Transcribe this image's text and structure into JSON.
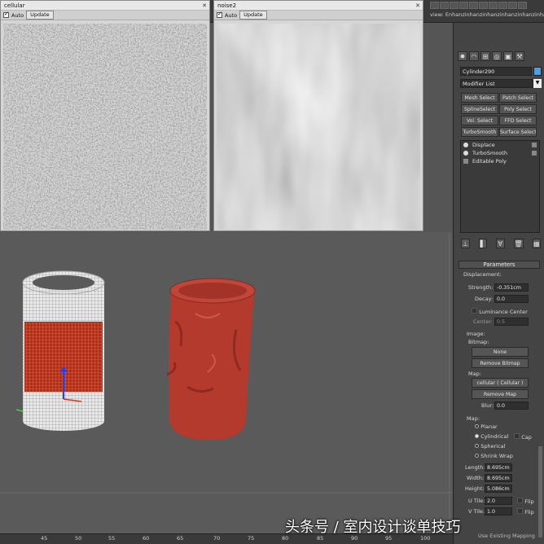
{
  "topbar": {
    "view_title": "view: Enhanzinhanzinhanzinhanzinhanzinhanzinhanz..."
  },
  "windows": [
    {
      "title": "cellular",
      "auto_label": "Auto",
      "update_label": "Update"
    },
    {
      "title": "noise2",
      "auto_label": "Auto",
      "update_label": "Update"
    }
  ],
  "command_panel": {
    "object_name": "Cylinder290",
    "modifier_list_label": "Modifier List",
    "modifier_buttons": [
      "Mesh Select",
      "Patch Select",
      "SplineSelect",
      "Poly Select",
      "Vol. Select",
      "FFD Select",
      "TurboSmooth",
      "Surface Select"
    ],
    "stack": [
      "Displace",
      "TurboSmooth",
      "Editable Poly"
    ],
    "parameters": {
      "rollout_title": "Parameters",
      "displacement_label": "Displacement:",
      "strength_label": "Strength:",
      "strength_value": "-0.351cm",
      "decay_label": "Decay:",
      "decay_value": "0.0",
      "luminance_center_label": "Luminance Center",
      "center_label": "Center:",
      "center_value": "0.5",
      "image_label": "Image:",
      "bitmap_label": "Bitmap:",
      "bitmap_button": "None",
      "remove_bitmap_button": "Remove Bitmap",
      "map_label": "Map:",
      "map_button": "cellular ( Cellular )",
      "remove_map_button": "Remove Map",
      "blur_label": "Blur:",
      "blur_value": "0.0",
      "maps_label": "Map:",
      "map_types": [
        "Planar",
        "Cylindrical",
        "Spherical",
        "Shrink Wrap"
      ],
      "cap_label": "Cap",
      "length_label": "Length:",
      "length_value": "8.695cm",
      "width_label": "Width:",
      "width_value": "8.695cm",
      "height_label": "Height:",
      "height_value": "5.086cm",
      "utile_label": "U Tile:",
      "utile_value": "2.0",
      "vtile_label": "V Tile:",
      "vtile_value": "1.0",
      "flip_label": "Flip",
      "bottom_hint": "Use Existing Mapping"
    }
  },
  "ruler": {
    "ticks": [
      "45",
      "50",
      "55",
      "60",
      "65",
      "70",
      "75",
      "80",
      "85",
      "90",
      "95",
      "100"
    ]
  },
  "watermark": "头条号 / 室内设计谈单技巧"
}
